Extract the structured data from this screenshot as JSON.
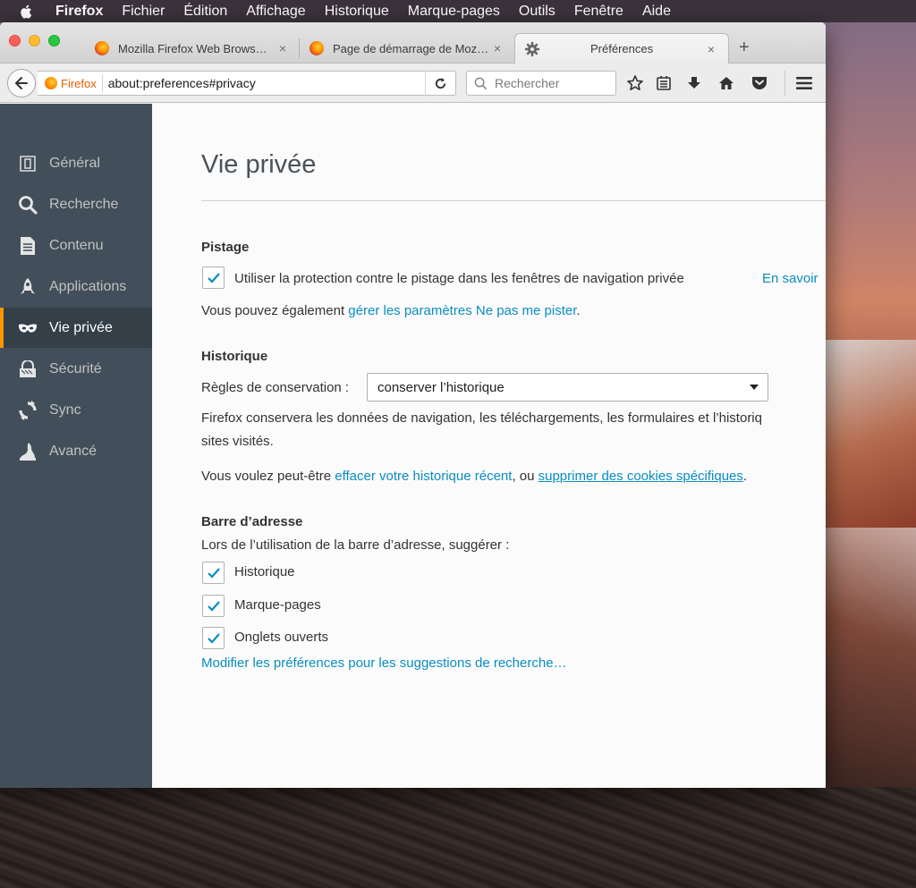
{
  "menubar": {
    "app_name": "Firefox",
    "items": [
      "Fichier",
      "Édition",
      "Affichage",
      "Historique",
      "Marque-pages",
      "Outils",
      "Fenêtre",
      "Aide"
    ]
  },
  "tabs": [
    {
      "label": "Mozilla Firefox Web Brows…",
      "active": false
    },
    {
      "label": "Page de démarrage de Moz…",
      "active": false
    },
    {
      "label": "Préférences",
      "active": true
    }
  ],
  "tab_close_glyph": "×",
  "new_tab_glyph": "+",
  "navbar": {
    "identity_label": "Firefox",
    "url": "about:preferences#privacy",
    "search_placeholder": "Rechercher"
  },
  "sidebar": {
    "items": [
      {
        "label": "Général",
        "icon": "general-icon"
      },
      {
        "label": "Recherche",
        "icon": "search-icon"
      },
      {
        "label": "Contenu",
        "icon": "content-icon"
      },
      {
        "label": "Applications",
        "icon": "applications-icon"
      },
      {
        "label": "Vie privée",
        "icon": "privacy-mask-icon",
        "active": true
      },
      {
        "label": "Sécurité",
        "icon": "security-icon"
      },
      {
        "label": "Sync",
        "icon": "sync-icon"
      },
      {
        "label": "Avancé",
        "icon": "advanced-icon"
      }
    ]
  },
  "content": {
    "title": "Vie privée",
    "tracking": {
      "heading": "Pistage",
      "checkbox_label": "Utiliser la protection contre le pistage dans les fenêtres de navigation privée",
      "checked": true,
      "learn_more": "En savoir",
      "dnt_prefix": "Vous pouvez également ",
      "dnt_link": "gérer les paramètres Ne pas me pister",
      "dnt_suffix": "."
    },
    "history": {
      "heading": "Historique",
      "rules_label": "Règles de conservation :",
      "rules_value": "conserver l’historique",
      "desc_line1": "Firefox conservera les données de navigation, les téléchargements, les formulaires et l’historiq",
      "desc_line2": "sites visités.",
      "recent_prefix": "Vous voulez peut-être ",
      "recent_link": "effacer votre historique récent",
      "recent_middle": ", ou ",
      "cookies_link": "supprimer des cookies spécifiques",
      "recent_suffix": "."
    },
    "addressbar": {
      "heading": "Barre d’adresse",
      "intro": "Lors de l’utilisation de la barre d’adresse, suggérer :",
      "options": [
        {
          "label": "Historique",
          "checked": true
        },
        {
          "label": "Marque-pages",
          "checked": true
        },
        {
          "label": "Onglets ouverts",
          "checked": true
        }
      ],
      "search_prefs_link": "Modifier les préférences pour les suggestions de recherche…"
    }
  },
  "colors": {
    "accent_link": "#0a8dc1",
    "sidebar_bg": "#424f5a",
    "sidebar_active_marker": "#ff9500",
    "identity_orange": "#e66000"
  }
}
